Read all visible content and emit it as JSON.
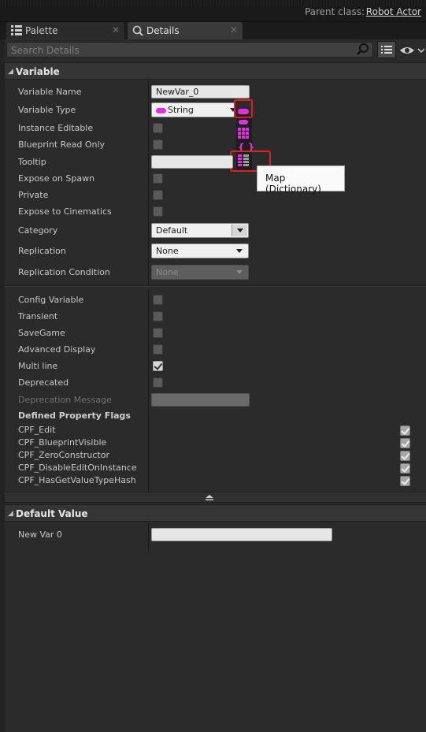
{
  "header": {
    "parent_class_label": "Parent class:",
    "parent_class_value": "Robot Actor"
  },
  "tabs": [
    {
      "label": "Palette"
    },
    {
      "label": "Details"
    }
  ],
  "search": {
    "placeholder": "Search Details"
  },
  "sections": {
    "variable": {
      "title": "Variable",
      "rows": {
        "variable_name": {
          "label": "Variable Name",
          "value": "NewVar_0"
        },
        "variable_type": {
          "label": "Variable Type",
          "value": "String"
        },
        "instance_editable": {
          "label": "Instance Editable"
        },
        "blueprint_read_only": {
          "label": "Blueprint Read Only"
        },
        "tooltip": {
          "label": "Tooltip",
          "value": ""
        },
        "expose_on_spawn": {
          "label": "Expose on Spawn"
        },
        "private": {
          "label": "Private"
        },
        "expose_to_cinematics": {
          "label": "Expose to Cinematics"
        },
        "category": {
          "label": "Category",
          "value": "Default"
        },
        "replication": {
          "label": "Replication",
          "value": "None"
        },
        "replication_condition": {
          "label": "Replication Condition",
          "value": "None"
        }
      }
    },
    "advanced": {
      "rows": {
        "config_variable": {
          "label": "Config Variable"
        },
        "transient": {
          "label": "Transient"
        },
        "savegame": {
          "label": "SaveGame"
        },
        "advanced_display": {
          "label": "Advanced Display"
        },
        "multi_line": {
          "label": "Multi line",
          "checked": true
        },
        "deprecated": {
          "label": "Deprecated"
        },
        "deprecation_message": {
          "label": "Deprecation Message"
        }
      },
      "flags_title": "Defined Property Flags",
      "flags": [
        "CPF_Edit",
        "CPF_BlueprintVisible",
        "CPF_ZeroConstructor",
        "CPF_DisableEditOnInstance",
        "CPF_HasGetValueTypeHash"
      ]
    },
    "default_value": {
      "title": "Default Value",
      "rows": {
        "new_var_0": {
          "label": "New Var 0",
          "value": ""
        }
      }
    }
  },
  "tooltip_popup": {
    "text": "Map (Dictionary)"
  },
  "colors": {
    "accent_string": "#e030e0",
    "highlight": "#e02020"
  }
}
